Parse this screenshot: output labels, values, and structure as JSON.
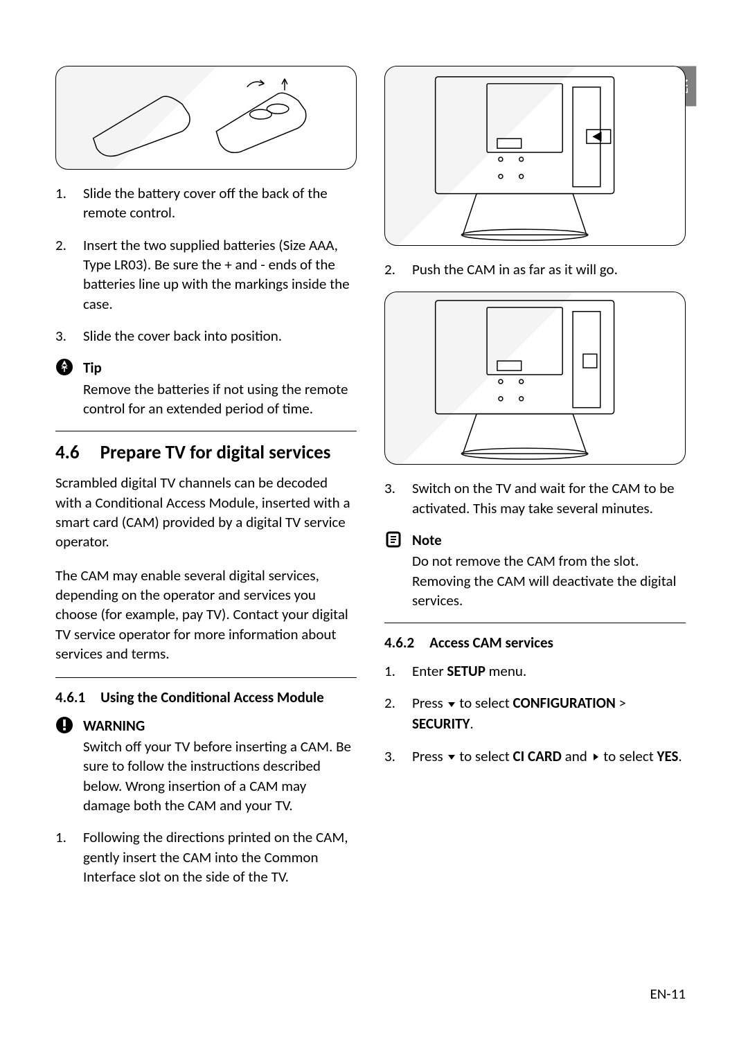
{
  "lang_tab": "EN",
  "left": {
    "steps_a": [
      "Slide the battery cover off the back of the remote control.",
      "Insert the two supplied batteries (Size AAA, Type LR03). Be sure the + and - ends of the batteries line up with the markings inside the case.",
      "Slide the cover back into position."
    ],
    "tip": {
      "title": "Tip",
      "body": "Remove the batteries if not using the remote control for an extended period of time."
    },
    "h2_num": "4.6",
    "h2_title": "Prepare TV for digital services",
    "para1": "Scrambled digital TV channels can be decoded with a Conditional Access Module, inserted with a smart card (CAM) provided by a digital TV service operator.",
    "para2": "The CAM may enable several digital services, depending on the operator and services you choose (for example, pay TV). Contact your digital TV service operator for more information about services and terms.",
    "h3_num": "4.6.1",
    "h3_title": "Using the Conditional Access Module",
    "warning": {
      "title": "WARNING",
      "body": "Switch off your TV before inserting a CAM. Be sure to follow the instructions described below. Wrong insertion of a CAM may damage both the CAM and your TV."
    },
    "steps_b": [
      "Following the directions printed on the CAM, gently insert the CAM into the Common Interface slot on the side of the TV."
    ]
  },
  "right": {
    "step2": "Push the CAM in as far as it will go.",
    "step3": "Switch on the TV and wait for the CAM to be activated. This may take several minutes.",
    "note": {
      "title": "Note",
      "body": "Do not remove the CAM from the slot. Removing the CAM will deactivate the digital services."
    },
    "h3_num": "4.6.2",
    "h3_title": "Access CAM services",
    "access": {
      "s1_a": "Enter ",
      "s1_b": "SETUP",
      "s1_c": " menu.",
      "s2_a": "Press ",
      "s2_b": " to select ",
      "s2_c": "CONFIGURATION",
      "s2_d": " > ",
      "s2_e": "SECURITY",
      "s2_f": ".",
      "s3_a": "Press ",
      "s3_b": " to select ",
      "s3_c": "CI CARD",
      "s3_d": " and ",
      "s3_e": " to select ",
      "s3_f": "YES",
      "s3_g": "."
    }
  },
  "footer": "EN-11"
}
